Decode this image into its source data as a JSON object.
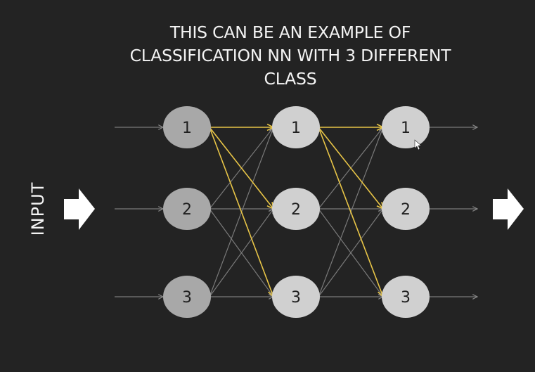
{
  "title_lines": [
    "THIS CAN BE AN EXAMPLE OF",
    "CLASSIFICATION NN WITH 3 DIFFERENT",
    "CLASS"
  ],
  "input_label": "INPUT",
  "layers": [
    {
      "nodes": [
        "1",
        "2",
        "3"
      ]
    },
    {
      "nodes": [
        "1",
        "2",
        "3"
      ]
    },
    {
      "nodes": [
        "1",
        "2",
        "3"
      ]
    }
  ],
  "highlighted_connections": [
    {
      "from_layer": 0,
      "from_node": 0,
      "to_node": 0
    },
    {
      "from_layer": 0,
      "from_node": 0,
      "to_node": 1
    },
    {
      "from_layer": 0,
      "from_node": 0,
      "to_node": 2
    },
    {
      "from_layer": 1,
      "from_node": 0,
      "to_node": 0
    },
    {
      "from_layer": 1,
      "from_node": 0,
      "to_node": 1
    },
    {
      "from_layer": 1,
      "from_node": 0,
      "to_node": 2
    }
  ],
  "colors": {
    "background": "#232323",
    "text": "#f4f4f4",
    "first_layer_node": "#a8a8a8",
    "other_layer_node": "#d0d0d0",
    "connection": "#7a7a7a",
    "highlight": "#e8c547",
    "arrow": "#ffffff"
  }
}
